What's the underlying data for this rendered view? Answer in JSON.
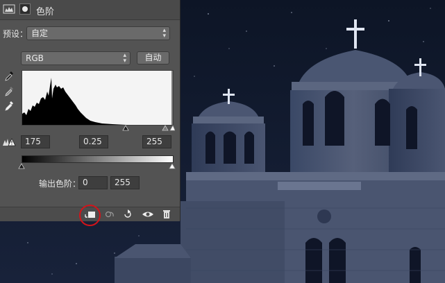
{
  "panel": {
    "title": "色阶",
    "preset": {
      "label": "预设：",
      "value": "自定"
    },
    "channel": {
      "value": "RGB"
    },
    "auto_button": "自动",
    "input": {
      "black": "175",
      "gamma": "0.25",
      "white": "255"
    },
    "output": {
      "label": "输出色阶：",
      "black": "0",
      "white": "255"
    }
  },
  "icons": {
    "header": [
      "levels-adjustment-icon",
      "layer-mask-icon"
    ],
    "eyedroppers": [
      "black-point-eyedropper-icon",
      "gray-point-eyedropper-icon",
      "white-point-eyedropper-icon"
    ],
    "footer": [
      "clip-to-layer-icon",
      "view-previous-state-icon",
      "reset-icon",
      "toggle-visibility-icon",
      "delete-icon"
    ]
  },
  "colors": {
    "panel_bg": "#535353",
    "highlight_ring": "#d2141a",
    "sky": "#101827"
  }
}
